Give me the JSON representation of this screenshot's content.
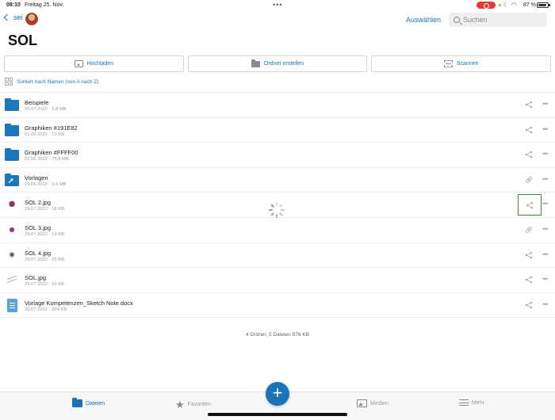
{
  "status_bar": {
    "time": "08:10",
    "date": "Freitag 25. Nov.",
    "battery_pct": "87 %",
    "battery_level": 0.87
  },
  "nav": {
    "back_label": "sei",
    "select_label": "Auswählen",
    "search_placeholder": "Suchen"
  },
  "page_title": "SOL",
  "actions": {
    "upload": "Hochladen",
    "create_folder": "Ordner erstellen",
    "scan": "Scannen"
  },
  "sort_label": "Sortiert nach Namen (von A nach Z)",
  "items": [
    {
      "name": "Beispiele",
      "meta": "20.07.2022 · 2,8 MB",
      "kind": "folder",
      "action": "share-icon"
    },
    {
      "name": "Graphiken #191E82",
      "meta": "01.06.2022 · 15 KB",
      "kind": "folder",
      "action": "share-icon"
    },
    {
      "name": "Graphiken #FFFF00",
      "meta": "02.06.2022 · 75,8 MB",
      "kind": "folder",
      "action": "share-icon"
    },
    {
      "name": "Vorlagen",
      "meta": "29.06.2022 · 3,6 MB",
      "kind": "shared-folder",
      "action": "link-icon"
    },
    {
      "name": "SOL 2.jpg",
      "meta": "29.07.2022 · 18 KB",
      "kind": "image-star",
      "action": "share-icon"
    },
    {
      "name": "SOL 3.jpg",
      "meta": "29.07.2022 · 13 KB",
      "kind": "image-dot",
      "action": "link-icon"
    },
    {
      "name": "SOL 4.jpg",
      "meta": "29.07.2022 · 25 KB",
      "kind": "image-bulb",
      "action": "share-icon"
    },
    {
      "name": "SOL.jpg",
      "meta": "29.07.2022 · 16 KB",
      "kind": "image-sketch",
      "action": "share-icon"
    },
    {
      "name": "Vorlage Kompetenzen_Sketch Note.docx",
      "meta": "20.07.2022 · 904 KB",
      "kind": "document",
      "action": "share-icon"
    }
  ],
  "summary": "4 Ordner, 5 Dateien 976 KB",
  "tabs": [
    {
      "label": "Dateien",
      "icon": "folder-icon"
    },
    {
      "label": "Favoriten",
      "icon": "star-icon"
    },
    {
      "label": "Medien",
      "icon": "media-icon"
    },
    {
      "label": "Mehr",
      "icon": "menu-icon"
    }
  ],
  "fab_label": "+",
  "colors": {
    "accent": "#1a73b8",
    "folder": "#1e77b8",
    "focus_ring": "#3a8a3a"
  }
}
